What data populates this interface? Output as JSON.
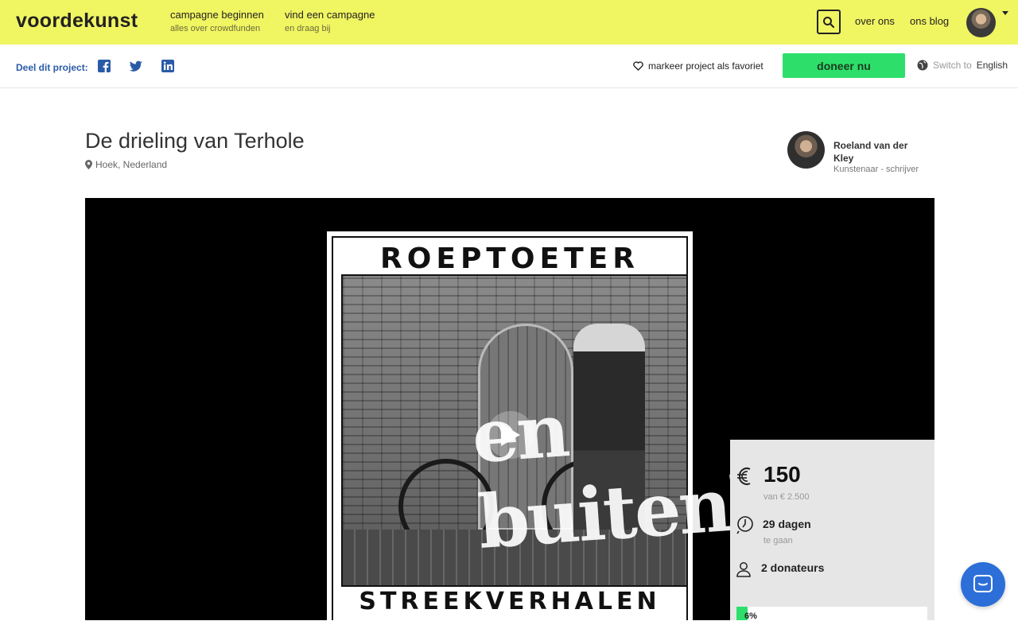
{
  "header": {
    "logo": "voordekunst",
    "nav": [
      {
        "label": "campagne beginnen",
        "sub": "alles over crowdfunden"
      },
      {
        "label": "vind een campagne",
        "sub": "en draag bij"
      }
    ],
    "links": {
      "about": "over ons",
      "blog": "ons blog"
    },
    "search_icon": "search-icon",
    "avatar_icon": "user-avatar"
  },
  "sharebar": {
    "label": "Deel dit project:",
    "icons": [
      "facebook-icon",
      "twitter-icon",
      "linkedin-icon"
    ],
    "favorite": "markeer project als favoriet",
    "donate": "doneer nu",
    "switch_prefix": "Switch to",
    "switch_lang": "English"
  },
  "project": {
    "title": "De drieling van Terhole",
    "location": "Hoek, Nederland",
    "author_name": "Roeland van der Kley",
    "author_role": "Kunstenaar - schrijver"
  },
  "video": {
    "poster_top": "ROEPTOETER",
    "poster_bottom": "STREEKVERHALEN",
    "overlay": "en buitenlui"
  },
  "stats": {
    "amount": "150",
    "goal": "van € 2.500",
    "days": "29 dagen",
    "days_sub": "te gaan",
    "donors": "2 donateurs",
    "progress_label": "6%",
    "progress_fraction": 0.06
  },
  "colors": {
    "header_bg": "#f0f562",
    "accent_green": "#2ddf6a",
    "share_blue": "#2a5ba7",
    "chat_blue": "#2d6fd8"
  }
}
